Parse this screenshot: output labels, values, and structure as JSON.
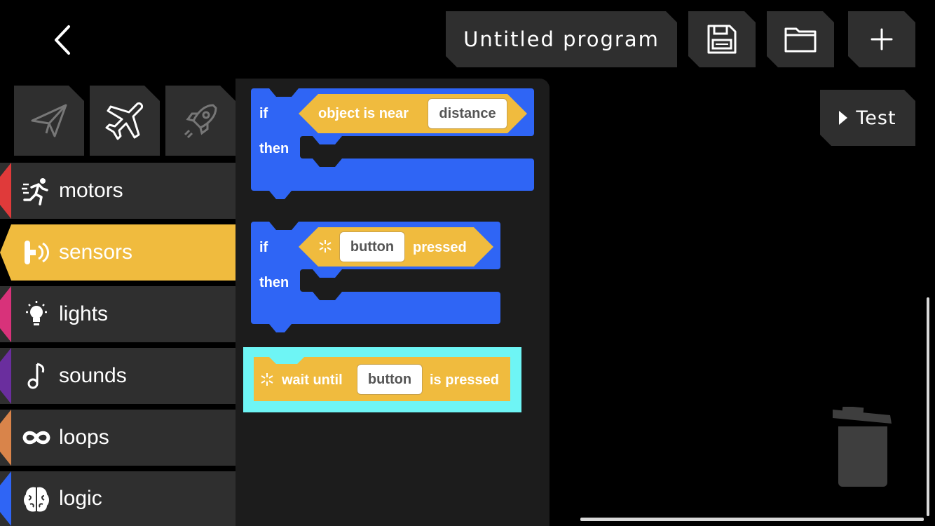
{
  "header": {
    "program_title": "Untitled program",
    "icons": {
      "back": "chevron-left-icon",
      "save": "floppy-disk-icon",
      "open": "folder-icon",
      "new": "plus-icon"
    }
  },
  "test_button": {
    "label": "Test",
    "icon": "play-icon"
  },
  "mode_tabs": [
    {
      "icon": "paper-plane-icon",
      "active": false
    },
    {
      "icon": "airplane-icon",
      "active": true
    },
    {
      "icon": "rocket-icon",
      "active": false
    }
  ],
  "categories": [
    {
      "label": "motors",
      "color": "#e03a3a",
      "icon": "running-man-icon"
    },
    {
      "label": "sensors",
      "color": "#f0bb3e",
      "icon": "sensor-icon",
      "active": true
    },
    {
      "label": "lights",
      "color": "#d8327a",
      "icon": "lightbulb-icon"
    },
    {
      "label": "sounds",
      "color": "#6a2e9e",
      "icon": "music-note-icon"
    },
    {
      "label": "loops",
      "color": "#d9844a",
      "icon": "infinity-icon"
    },
    {
      "label": "logic",
      "color": "#2f65f5",
      "icon": "brain-icon"
    }
  ],
  "blocks": {
    "if_near": {
      "if": "if",
      "then": "then",
      "condition": "object is near",
      "param": "distance"
    },
    "if_button": {
      "if": "if",
      "then": "then",
      "param": "button",
      "suffix": "pressed"
    },
    "wait_until": {
      "prefix": "wait until",
      "param": "button",
      "suffix": "is pressed"
    }
  },
  "colors": {
    "block_blue": "#2f65f5",
    "block_yellow": "#f0bb3e",
    "highlight_cyan": "#6ef5f5",
    "panel": "#2f2f2f",
    "palette": "#1c1c1c"
  },
  "trash": {
    "icon": "trash-can-icon"
  }
}
